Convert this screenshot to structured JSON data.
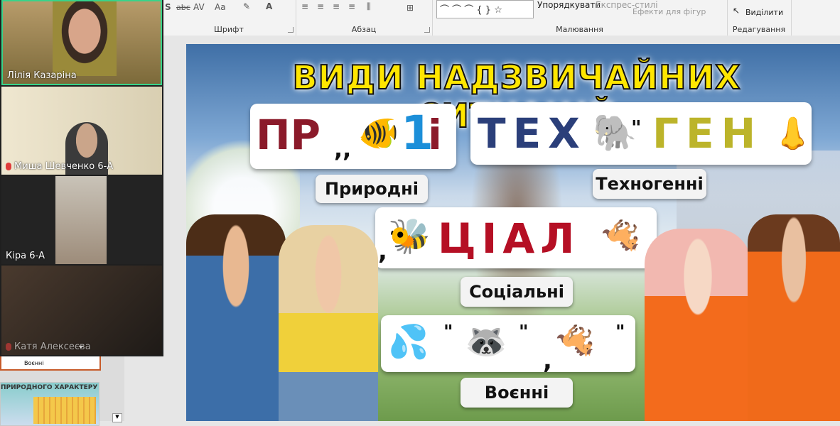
{
  "ribbon": {
    "font_group": "Шрифт",
    "paragraph_group": "Абзац",
    "drawing_group": "Малювання",
    "editing_group": "Редагування",
    "arrange": "Упорядкувати",
    "quick_styles": "Експрес-стилі",
    "shape_effects": "Ефекти для фігур",
    "select": "Виділити",
    "font_abbr_aa": "Aa",
    "strike_abc": "abc",
    "av_spacing": "AV",
    "s_shadow": "S"
  },
  "slide": {
    "title": "ВИДИ НАДЗВИЧАЙНИХ СИТУАЦІЙ",
    "rebus1": {
      "pre": "ПР",
      "comma": ",,",
      "digit": "1",
      "post": "і"
    },
    "rebus2": {
      "letters": "ТЕХ",
      "quote": "\"",
      "mid": "ГЕН"
    },
    "rebus3": {
      "comma": ",",
      "letters": "ЦІАЛ"
    },
    "rebus4": {
      "q1": "\"",
      "q2": "\"",
      "comma": ","
    },
    "label_natural": "Природні",
    "label_technogenic": "Техногенні",
    "label_social": "Соціальні",
    "label_military": "Воєнні"
  },
  "thumbnails": {
    "thumb1_caption": "Воєнні",
    "thumb2_caption": "ПРИРОДНОГО ХАРАКТЕРУ"
  },
  "participants": [
    {
      "name": "Лілія Казаріна",
      "muted": false
    },
    {
      "name": "Миша Шевченко 6-А",
      "muted": true
    },
    {
      "name": "Кіра 6-А",
      "muted": false
    },
    {
      "name": "Катя Алексеєва",
      "muted": true
    }
  ],
  "colors": {
    "active_speaker": "#38d38a",
    "title_yellow": "#ffe600"
  }
}
